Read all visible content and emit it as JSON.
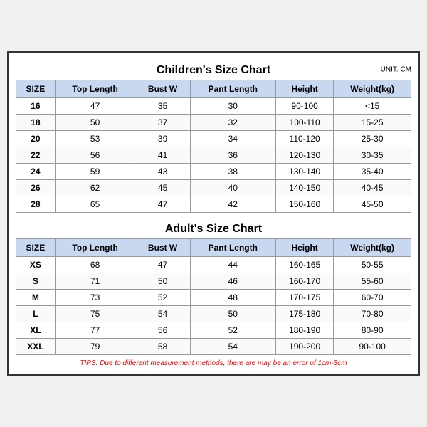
{
  "children_title": "Children's Size Chart",
  "adult_title": "Adult's Size Chart",
  "unit_label": "UNIT: CM",
  "headers": [
    "SIZE",
    "Top Length",
    "Bust W",
    "Pant Length",
    "Height",
    "Weight(kg)"
  ],
  "children_rows": [
    {
      "size": "16",
      "top_length": "47",
      "bust_w": "35",
      "pant_length": "30",
      "height": "90-100",
      "weight": "<15"
    },
    {
      "size": "18",
      "top_length": "50",
      "bust_w": "37",
      "pant_length": "32",
      "height": "100-110",
      "weight": "15-25"
    },
    {
      "size": "20",
      "top_length": "53",
      "bust_w": "39",
      "pant_length": "34",
      "height": "110-120",
      "weight": "25-30"
    },
    {
      "size": "22",
      "top_length": "56",
      "bust_w": "41",
      "pant_length": "36",
      "height": "120-130",
      "weight": "30-35"
    },
    {
      "size": "24",
      "top_length": "59",
      "bust_w": "43",
      "pant_length": "38",
      "height": "130-140",
      "weight": "35-40"
    },
    {
      "size": "26",
      "top_length": "62",
      "bust_w": "45",
      "pant_length": "40",
      "height": "140-150",
      "weight": "40-45"
    },
    {
      "size": "28",
      "top_length": "65",
      "bust_w": "47",
      "pant_length": "42",
      "height": "150-160",
      "weight": "45-50"
    }
  ],
  "adult_rows": [
    {
      "size": "XS",
      "top_length": "68",
      "bust_w": "47",
      "pant_length": "44",
      "height": "160-165",
      "weight": "50-55"
    },
    {
      "size": "S",
      "top_length": "71",
      "bust_w": "50",
      "pant_length": "46",
      "height": "160-170",
      "weight": "55-60"
    },
    {
      "size": "M",
      "top_length": "73",
      "bust_w": "52",
      "pant_length": "48",
      "height": "170-175",
      "weight": "60-70"
    },
    {
      "size": "L",
      "top_length": "75",
      "bust_w": "54",
      "pant_length": "50",
      "height": "175-180",
      "weight": "70-80"
    },
    {
      "size": "XL",
      "top_length": "77",
      "bust_w": "56",
      "pant_length": "52",
      "height": "180-190",
      "weight": "80-90"
    },
    {
      "size": "XXL",
      "top_length": "79",
      "bust_w": "58",
      "pant_length": "54",
      "height": "190-200",
      "weight": "90-100"
    }
  ],
  "tips": "TIPS: Due to different measurement methods, there are may be an error of 1cm-3cm"
}
